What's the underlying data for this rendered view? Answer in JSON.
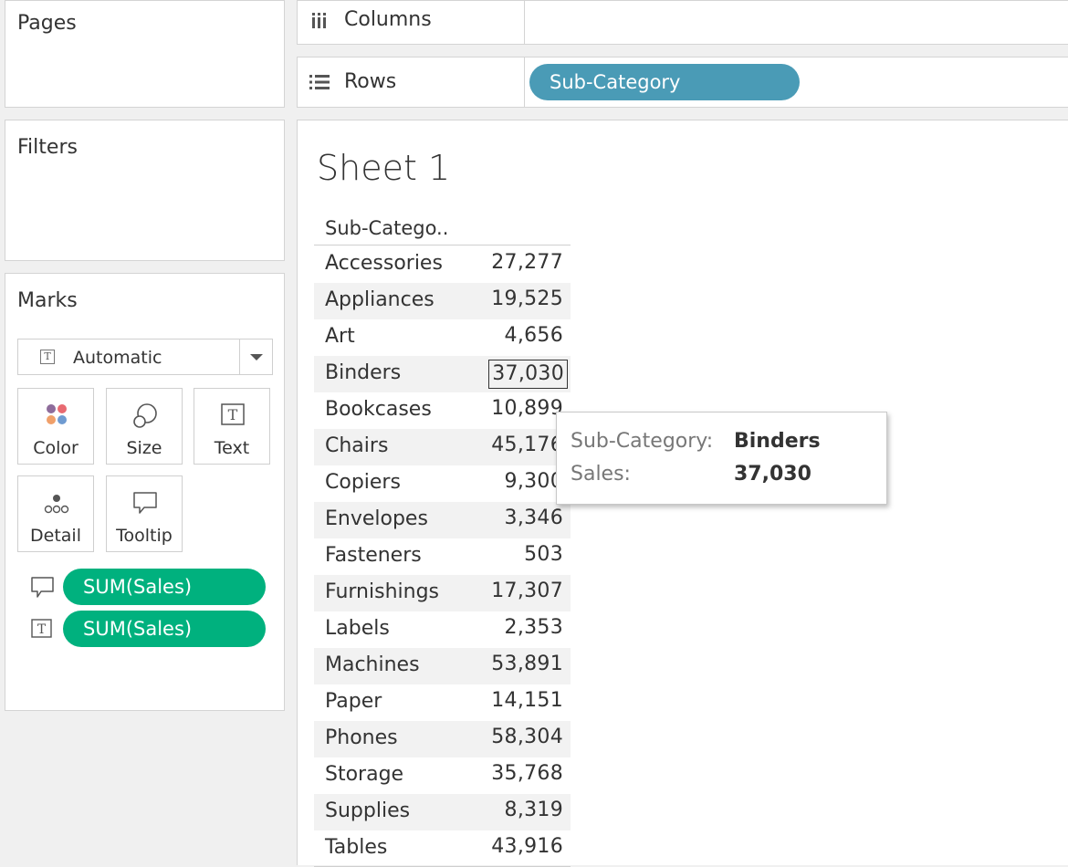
{
  "pages_card": {
    "title": "Pages"
  },
  "filters_card": {
    "title": "Filters"
  },
  "marks_card": {
    "title": "Marks",
    "mark_type": "Automatic",
    "buttons": {
      "color": "Color",
      "size": "Size",
      "text": "Text",
      "detail": "Detail",
      "tooltip": "Tooltip"
    },
    "fields": [
      {
        "icon": "tooltip-icon",
        "label": "SUM(Sales)"
      },
      {
        "icon": "text-icon",
        "label": "SUM(Sales)"
      }
    ]
  },
  "shelves": {
    "columns_label": "Columns",
    "rows_label": "Rows",
    "rows_pill": "Sub-Category"
  },
  "view": {
    "title": "Sheet 1",
    "header": "Sub-Catego..",
    "rows": [
      {
        "cat": "Accessories",
        "val": "27,277"
      },
      {
        "cat": "Appliances",
        "val": "19,525"
      },
      {
        "cat": "Art",
        "val": "4,656"
      },
      {
        "cat": "Binders",
        "val": "37,030"
      },
      {
        "cat": "Bookcases",
        "val": "10,899"
      },
      {
        "cat": "Chairs",
        "val": "45,176"
      },
      {
        "cat": "Copiers",
        "val": "9,300"
      },
      {
        "cat": "Envelopes",
        "val": "3,346"
      },
      {
        "cat": "Fasteners",
        "val": "503"
      },
      {
        "cat": "Furnishings",
        "val": "17,307"
      },
      {
        "cat": "Labels",
        "val": "2,353"
      },
      {
        "cat": "Machines",
        "val": "53,891"
      },
      {
        "cat": "Paper",
        "val": "14,151"
      },
      {
        "cat": "Phones",
        "val": "58,304"
      },
      {
        "cat": "Storage",
        "val": "35,768"
      },
      {
        "cat": "Supplies",
        "val": "8,319"
      },
      {
        "cat": "Tables",
        "val": "43,916"
      }
    ],
    "selected_index": 3
  },
  "tooltip": {
    "cat_key": "Sub-Category:",
    "cat_value": "Binders",
    "sales_key": "Sales:",
    "sales_value": "37,030"
  },
  "colors": {
    "measure_pill": "#00b17e",
    "dimension_pill": "#4a9bb6",
    "color_dots": [
      "#8e6c9b",
      "#e86a71",
      "#f0a06a",
      "#6f9bd1"
    ]
  }
}
